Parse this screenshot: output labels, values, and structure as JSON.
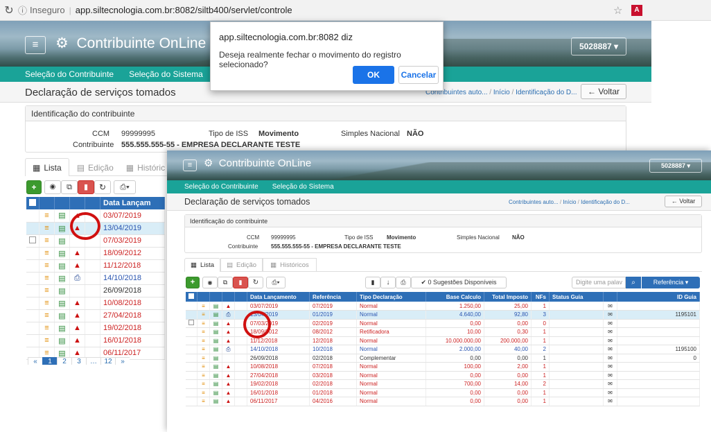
{
  "browser": {
    "insecure_label": "Inseguro",
    "url": "app.siltecnologia.com.br:8082/siltb400/servlet/controle"
  },
  "app": {
    "brand": "Contribuinte OnLine",
    "user_id": "5028887",
    "menu": [
      "Seleção do Contribuinte",
      "Seleção do Sistema"
    ],
    "page_title": "Declaração de serviços tomados",
    "breadcrumb": [
      "Contribuintes auto...",
      "Início",
      "Identificação do D..."
    ],
    "back_label": "Voltar"
  },
  "contribuinte": {
    "panel_title": "Identificação do contribuinte",
    "ccm_label": "CCM",
    "ccm_value": "99999995",
    "tipo_iss_label": "Tipo de ISS",
    "tipo_iss_value": "Movimento",
    "simples_label": "Simples Nacional",
    "simples_value": "NÃO",
    "contribuinte_label": "Contribuinte",
    "contribuinte_value": "555.555.555-55 - EMPRESA DECLARANTE TESTE"
  },
  "tabs": {
    "lista": "Lista",
    "edicao": "Edição",
    "historicos": "Históricos",
    "historicos_short": "Históric"
  },
  "toolbar": {
    "sugestoes": "0 Sugestões Disponíveis",
    "search_placeholder": "Digite uma palav",
    "referencia": "Referência"
  },
  "table": {
    "headers": [
      "Data Lançamento",
      "Referência",
      "Tipo Declaração",
      "Base Calculo",
      "Total Imposto",
      "NFs",
      "Status Guia",
      "ID Guia"
    ],
    "header_short": "Data Lançam",
    "rows": [
      {
        "data": "03/07/2019",
        "ref": "07/2019",
        "tipo": "Normal",
        "base": "1.250,00",
        "total": "25,00",
        "nfs": "1",
        "id": ""
      },
      {
        "data": "13/04/2019",
        "ref": "01/2019",
        "tipo": "Normal",
        "base": "4.640,00",
        "total": "92,80",
        "nfs": "3",
        "id": "1195101"
      },
      {
        "data": "07/03/2019",
        "ref": "02/2019",
        "tipo": "Normal",
        "base": "0,00",
        "total": "0,00",
        "nfs": "0",
        "id": ""
      },
      {
        "data": "18/09/2012",
        "ref": "08/2012",
        "tipo": "Retificadora",
        "base": "10,00",
        "total": "0,30",
        "nfs": "1",
        "id": ""
      },
      {
        "data": "11/12/2018",
        "ref": "12/2018",
        "tipo": "Normal",
        "base": "10.000.000,00",
        "total": "200.000,00",
        "nfs": "1",
        "id": ""
      },
      {
        "data": "14/10/2018",
        "ref": "10/2018",
        "tipo": "Normal",
        "base": "2.000,00",
        "total": "40,00",
        "nfs": "2",
        "id": "1195100"
      },
      {
        "data": "26/09/2018",
        "ref": "02/2018",
        "tipo": "Complementar",
        "base": "0,00",
        "total": "0,00",
        "nfs": "1",
        "id": "0"
      },
      {
        "data": "10/08/2018",
        "ref": "07/2018",
        "tipo": "Normal",
        "base": "100,00",
        "total": "2,00",
        "nfs": "1",
        "id": ""
      },
      {
        "data": "27/04/2018",
        "ref": "03/2018",
        "tipo": "Normal",
        "base": "0,00",
        "total": "0,00",
        "nfs": "1",
        "id": ""
      },
      {
        "data": "19/02/2018",
        "ref": "02/2018",
        "tipo": "Normal",
        "base": "700,00",
        "total": "14,00",
        "nfs": "2",
        "id": ""
      },
      {
        "data": "16/01/2018",
        "ref": "01/2018",
        "tipo": "Normal",
        "base": "0,00",
        "total": "0,00",
        "nfs": "1",
        "id": ""
      },
      {
        "data": "06/11/2017",
        "ref": "04/2016",
        "tipo": "Normal",
        "base": "0,00",
        "total": "0,00",
        "nfs": "1",
        "id": ""
      }
    ]
  },
  "pagination": [
    "1",
    "2",
    "3",
    "12"
  ],
  "dialog": {
    "title": "app.siltecnologia.com.br:8082 diz",
    "message": "Deseja realmente fechar o movimento do registro selecionado?",
    "ok": "OK",
    "cancel": "Cancelar"
  },
  "colors": {
    "teal": "#1aa398",
    "header_blue": "#2e6fb7",
    "red_text": "#cc2222",
    "blue_text": "#2a55b0"
  },
  "icons": {
    "list": "list-icon",
    "calc": "calculator-icon",
    "lock": "lock-icon",
    "print": "print-icon",
    "mail": "envelope-icon"
  }
}
